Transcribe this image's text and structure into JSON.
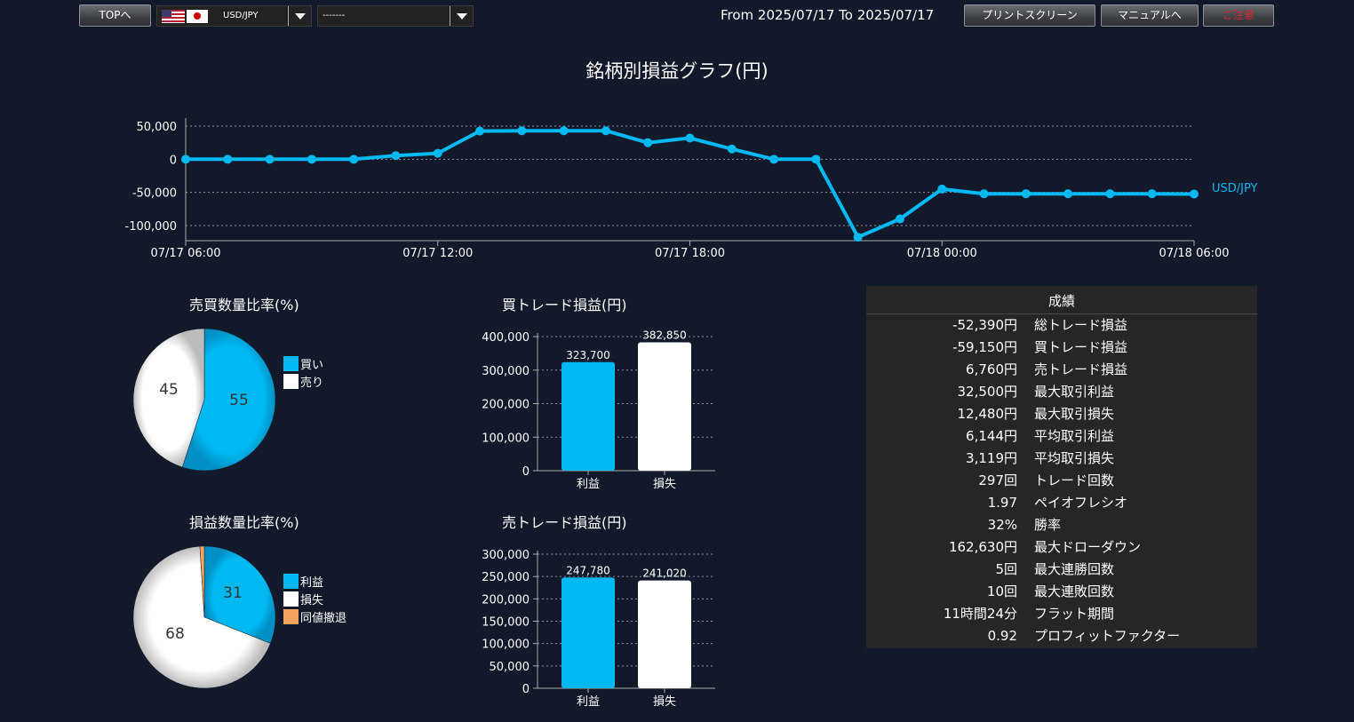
{
  "toolbar": {
    "top_label": "TOPへ",
    "pair": "USD/JPY",
    "second_select": "-------",
    "date_range": "From 2025/07/17 To 2025/07/17",
    "print_label": "プリントスクリーン",
    "manual_label": "マニュアルへ",
    "caution_label": "ご注意"
  },
  "main_title": "銘柄別損益グラフ(円)",
  "line_chart": {
    "series_name": "USD/JPY",
    "color": "#00b9f2",
    "y_ticks": [
      "50,000",
      "0",
      "-50,000",
      "-100,000"
    ],
    "x_ticks": [
      "07/17 06:00",
      "07/17 12:00",
      "07/17 18:00",
      "07/18 00:00",
      "07/18 06:00"
    ]
  },
  "pie1": {
    "title": "売買数量比率(%)",
    "legend": [
      "買い",
      "売り"
    ],
    "values_text": [
      "55",
      "45"
    ]
  },
  "pie2": {
    "title": "損益数量比率(%)",
    "legend": [
      "利益",
      "損失",
      "同値撤退"
    ],
    "values_text": [
      "31",
      "68"
    ]
  },
  "bar1": {
    "title": "買トレード損益(円)",
    "y_ticks": [
      "400,000",
      "300,000",
      "200,000",
      "100,000",
      "0"
    ],
    "categories": [
      "利益",
      "損失"
    ],
    "labels": [
      "323,700",
      "382,850"
    ]
  },
  "bar2": {
    "title": "売トレード損益(円)",
    "y_ticks": [
      "300,000",
      "250,000",
      "200,000",
      "150,000",
      "100,000",
      "50,000",
      "0"
    ],
    "categories": [
      "利益",
      "損失"
    ],
    "labels": [
      "247,780",
      "241,020"
    ]
  },
  "stats": {
    "title": "成績",
    "rows": [
      {
        "value": "-52,390円",
        "label": "総トレード損益"
      },
      {
        "value": "-59,150円",
        "label": "買トレード損益"
      },
      {
        "value": "6,760円",
        "label": "売トレード損益"
      },
      {
        "value": "32,500円",
        "label": "最大取引利益"
      },
      {
        "value": "12,480円",
        "label": "最大取引損失"
      },
      {
        "value": "6,144円",
        "label": "平均取引利益"
      },
      {
        "value": "3,119円",
        "label": "平均取引損失"
      },
      {
        "value": "297回",
        "label": "トレード回数"
      },
      {
        "value": "1.97",
        "label": "ペイオフレシオ"
      },
      {
        "value": "32%",
        "label": "勝率"
      },
      {
        "value": "162,630円",
        "label": "最大ドローダウン"
      },
      {
        "value": "5回",
        "label": "最大連勝回数"
      },
      {
        "value": "10回",
        "label": "最大連敗回数"
      },
      {
        "value": "11時間24分",
        "label": "フラット期間"
      },
      {
        "value": "0.92",
        "label": "プロフィットファクター"
      }
    ]
  },
  "colors": {
    "blue": "#00b9f2",
    "white": "#ffffff",
    "orange": "#f4a460",
    "bg": "#11192a"
  },
  "chart_data": [
    {
      "type": "line",
      "title": "銘柄別損益グラフ(円)",
      "series": [
        {
          "name": "USD/JPY",
          "x": [
            "07/17 06:00",
            "07/17 07:00",
            "07/17 08:00",
            "07/17 09:00",
            "07/17 10:00",
            "07/17 11:00",
            "07/17 12:00",
            "07/17 13:00",
            "07/17 14:00",
            "07/17 15:00",
            "07/17 16:00",
            "07/17 17:00",
            "07/17 18:00",
            "07/17 19:00",
            "07/17 20:00",
            "07/17 21:00",
            "07/17 22:00",
            "07/17 23:00",
            "07/18 00:00",
            "07/18 01:00",
            "07/18 02:00",
            "07/18 03:00",
            "07/18 04:00",
            "07/18 05:00",
            "07/18 06:00"
          ],
          "values": [
            0,
            0,
            0,
            0,
            0,
            5500,
            9000,
            42500,
            43000,
            43000,
            43000,
            25000,
            32000,
            15500,
            0,
            0,
            -117500,
            -90000,
            -45000,
            -52000,
            -52000,
            -52000,
            -52000,
            -52000,
            -52390
          ]
        }
      ],
      "ylim": [
        -110000,
        50000
      ],
      "y_ticks": [
        50000,
        0,
        -50000,
        -100000
      ],
      "x_ticks": [
        "07/17 06:00",
        "07/17 12:00",
        "07/17 18:00",
        "07/18 00:00",
        "07/18 06:00"
      ],
      "grid": true,
      "legend": "right"
    },
    {
      "type": "pie",
      "title": "売買数量比率(%)",
      "categories": [
        "買い",
        "売り"
      ],
      "values": [
        55,
        45
      ]
    },
    {
      "type": "pie",
      "title": "損益数量比率(%)",
      "categories": [
        "利益",
        "損失",
        "同値撤退"
      ],
      "values": [
        31,
        68,
        1
      ]
    },
    {
      "type": "bar",
      "title": "買トレード損益(円)",
      "categories": [
        "利益",
        "損失"
      ],
      "values": [
        323700,
        382850
      ],
      "ylim": [
        0,
        400000
      ]
    },
    {
      "type": "bar",
      "title": "売トレード損益(円)",
      "categories": [
        "利益",
        "損失"
      ],
      "values": [
        247780,
        241020
      ],
      "ylim": [
        0,
        300000
      ]
    }
  ]
}
